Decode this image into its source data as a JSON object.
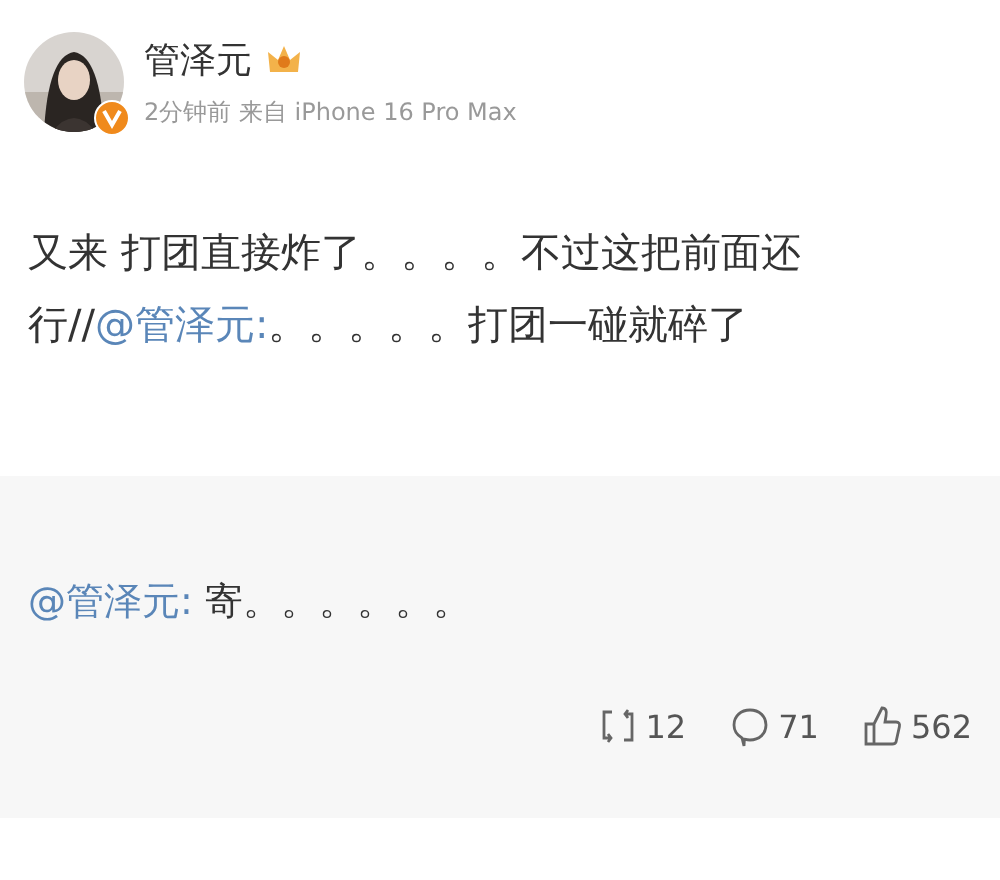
{
  "author": {
    "name": "管泽元",
    "meta": "2分钟前 来自 iPhone 16 Pro Max"
  },
  "post": {
    "segments": [
      {
        "kind": "text",
        "text": "又来 打团直接炸了。。。。不过这把前面还行//"
      },
      {
        "kind": "mention",
        "text": "@管泽元:"
      },
      {
        "kind": "text",
        "text": "。。。。。打团一碰就碎了"
      }
    ]
  },
  "repost": {
    "segments": [
      {
        "kind": "mention",
        "text": "@管泽元:"
      },
      {
        "kind": "text",
        "text": " 寄。。。。。。"
      }
    ]
  },
  "stats": [
    {
      "kind": "repost",
      "count": "12"
    },
    {
      "kind": "comment",
      "count": "71"
    },
    {
      "kind": "like",
      "count": "562"
    }
  ]
}
